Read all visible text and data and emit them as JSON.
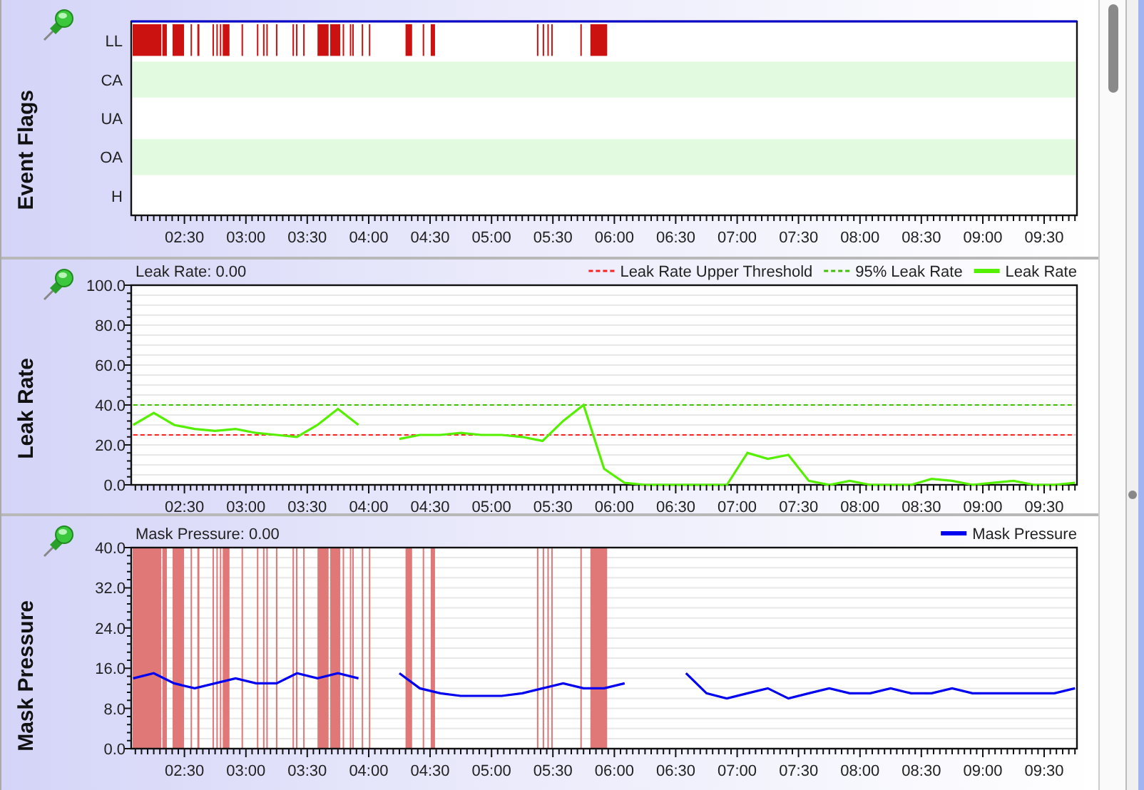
{
  "panels": [
    {
      "kind": "events",
      "title": "Event Flags",
      "chart_data": {
        "type": "bar",
        "orientation": "horizontal",
        "categories": [
          "LL",
          "CA",
          "UA",
          "OA",
          "H"
        ],
        "xlim": [
          124,
          586
        ],
        "bands": [
          {
            "axis": "x",
            "from": 124.7,
            "to": 138.7
          },
          {
            "axis": "x",
            "from": 139.2,
            "to": 141.4
          },
          {
            "axis": "x",
            "from": 144.2,
            "to": 149.8
          },
          {
            "axis": "x",
            "from": 153,
            "to": 153.6
          },
          {
            "axis": "x",
            "from": 156.3,
            "to": 157.3
          },
          {
            "axis": "x",
            "from": 163.7,
            "to": 164.3
          },
          {
            "axis": "x",
            "from": 165.6,
            "to": 166.2
          },
          {
            "axis": "x",
            "from": 167.3,
            "to": 167.9
          },
          {
            "axis": "x",
            "from": 168.7,
            "to": 172
          },
          {
            "axis": "x",
            "from": 177.9,
            "to": 178.5
          },
          {
            "axis": "x",
            "from": 185.4,
            "to": 186
          },
          {
            "axis": "x",
            "from": 188.4,
            "to": 189
          },
          {
            "axis": "x",
            "from": 190,
            "to": 190.6
          },
          {
            "axis": "x",
            "from": 194.7,
            "to": 195.3
          },
          {
            "axis": "x",
            "from": 202.8,
            "to": 203.4
          },
          {
            "axis": "x",
            "from": 204.5,
            "to": 205.1
          },
          {
            "axis": "x",
            "from": 208,
            "to": 208.6
          },
          {
            "axis": "x",
            "from": 215,
            "to": 220.4
          },
          {
            "axis": "x",
            "from": 221.2,
            "to": 226.1
          },
          {
            "axis": "x",
            "from": 227.3,
            "to": 227.9
          },
          {
            "axis": "x",
            "from": 230.8,
            "to": 231.4
          },
          {
            "axis": "x",
            "from": 232,
            "to": 232.6
          },
          {
            "axis": "x",
            "from": 236.6,
            "to": 237.2
          },
          {
            "axis": "x",
            "from": 240.1,
            "to": 240.7
          },
          {
            "axis": "x",
            "from": 258,
            "to": 261.2
          },
          {
            "axis": "x",
            "from": 266.4,
            "to": 267
          },
          {
            "axis": "x",
            "from": 270.3,
            "to": 272.4
          },
          {
            "axis": "x",
            "from": 322.2,
            "to": 322.8
          },
          {
            "axis": "x",
            "from": 325,
            "to": 325.6
          },
          {
            "axis": "x",
            "from": 327.3,
            "to": 327.9
          },
          {
            "axis": "x",
            "from": 329.2,
            "to": 329.8
          },
          {
            "axis": "x",
            "from": 343.4,
            "to": 344
          },
          {
            "axis": "x",
            "from": 348.3,
            "to": 356.5
          }
        ],
        "xticks": [
          {
            "value": 150,
            "label": "02:30"
          },
          {
            "value": 180,
            "label": "03:00"
          },
          {
            "value": 210,
            "label": "03:30"
          },
          {
            "value": 240,
            "label": "04:00"
          },
          {
            "value": 270,
            "label": "04:30"
          },
          {
            "value": 300,
            "label": "05:00"
          },
          {
            "value": 330,
            "label": "05:30"
          },
          {
            "value": 360,
            "label": "06:00"
          },
          {
            "value": 390,
            "label": "06:30"
          },
          {
            "value": 420,
            "label": "07:00"
          },
          {
            "value": 450,
            "label": "07:30"
          },
          {
            "value": 480,
            "label": "08:00"
          },
          {
            "value": 510,
            "label": "08:30"
          },
          {
            "value": 540,
            "label": "09:00"
          },
          {
            "value": 570,
            "label": "09:30"
          }
        ]
      }
    },
    {
      "kind": "chart",
      "title": "Leak Rate",
      "readout": "Leak Rate: 0.00",
      "chart_data": {
        "type": "line",
        "xlim": [
          124,
          586
        ],
        "ylim": [
          0,
          100
        ],
        "grid": true,
        "legend": "top-right",
        "x": [
          125,
          135,
          145,
          155,
          165,
          175,
          185,
          195,
          205,
          215,
          225,
          235,
          245,
          255,
          265,
          275,
          285,
          295,
          305,
          315,
          325,
          335,
          345,
          355,
          365,
          375,
          385,
          395,
          405,
          415,
          425,
          435,
          445,
          455,
          465,
          475,
          485,
          495,
          505,
          515,
          525,
          535,
          545,
          555,
          565,
          575,
          585
        ],
        "series": [
          {
            "name": "Leak Rate Upper Threshold",
            "color": "#ff2020",
            "line_style": "dashed",
            "values": [
              25,
              25,
              25,
              25,
              25,
              25,
              25,
              25,
              25,
              25,
              25,
              25,
              25,
              25,
              25,
              25,
              25,
              25,
              25,
              25,
              25,
              25,
              25,
              25,
              25,
              25,
              25,
              25,
              25,
              25,
              25,
              25,
              25,
              25,
              25,
              25,
              25,
              25,
              25,
              25,
              25,
              25,
              25,
              25,
              25,
              25,
              25
            ]
          },
          {
            "name": "95% Leak Rate",
            "color": "#40c000",
            "line_style": "dashed",
            "values": [
              40,
              40,
              40,
              40,
              40,
              40,
              40,
              40,
              40,
              40,
              40,
              40,
              40,
              40,
              40,
              40,
              40,
              40,
              40,
              40,
              40,
              40,
              40,
              40,
              40,
              40,
              40,
              40,
              40,
              40,
              40,
              40,
              40,
              40,
              40,
              40,
              40,
              40,
              40,
              40,
              40,
              40,
              40,
              40,
              40,
              40,
              40
            ]
          },
          {
            "name": "Leak Rate",
            "color": "#55f000",
            "line_style": "solid",
            "values": [
              30,
              36,
              30,
              28,
              27,
              28,
              26,
              25,
              24,
              30,
              38,
              30,
              null,
              23,
              25,
              25,
              26,
              25,
              25,
              24,
              22,
              32,
              40,
              8,
              1,
              0,
              0,
              0,
              0,
              0,
              16,
              13,
              15,
              2,
              0,
              2,
              0,
              0,
              0,
              3,
              2,
              0,
              1,
              2,
              0,
              0,
              1
            ]
          }
        ],
        "xticks": [
          {
            "value": 150,
            "label": "02:30"
          },
          {
            "value": 180,
            "label": "03:00"
          },
          {
            "value": 210,
            "label": "03:30"
          },
          {
            "value": 240,
            "label": "04:00"
          },
          {
            "value": 270,
            "label": "04:30"
          },
          {
            "value": 300,
            "label": "05:00"
          },
          {
            "value": 330,
            "label": "05:30"
          },
          {
            "value": 360,
            "label": "06:00"
          },
          {
            "value": 390,
            "label": "06:30"
          },
          {
            "value": 420,
            "label": "07:00"
          },
          {
            "value": 450,
            "label": "07:30"
          },
          {
            "value": 480,
            "label": "08:00"
          },
          {
            "value": 510,
            "label": "08:30"
          },
          {
            "value": 540,
            "label": "09:00"
          },
          {
            "value": 570,
            "label": "09:30"
          }
        ],
        "yticks": [
          {
            "value": 0,
            "label": "0.0"
          },
          {
            "value": 20,
            "label": "20.0"
          },
          {
            "value": 40,
            "label": "40.0"
          },
          {
            "value": 60,
            "label": "60.0"
          },
          {
            "value": 80,
            "label": "80.0"
          },
          {
            "value": 100,
            "label": "100.0"
          }
        ]
      }
    },
    {
      "kind": "chart",
      "title": "Mask Pressure",
      "readout": "Mask Pressure: 0.00",
      "chart_data": {
        "type": "line",
        "xlim": [
          124,
          586
        ],
        "ylim": [
          0,
          40
        ],
        "grid": true,
        "legend": "top-right",
        "x": [
          125,
          135,
          145,
          155,
          165,
          175,
          185,
          195,
          205,
          215,
          225,
          235,
          245,
          255,
          265,
          275,
          285,
          295,
          305,
          315,
          325,
          335,
          345,
          355,
          365,
          375,
          385,
          395,
          405,
          415,
          425,
          435,
          445,
          455,
          465,
          475,
          485,
          495,
          505,
          515,
          525,
          535,
          545,
          555,
          565,
          575,
          585
        ],
        "series": [
          {
            "name": "Mask Pressure",
            "color": "#0000f0",
            "line_style": "solid",
            "values": [
              14,
              15,
              13,
              12,
              13,
              14,
              13,
              13,
              15,
              14,
              15,
              14,
              null,
              15,
              12,
              11,
              10.5,
              10.5,
              10.5,
              11,
              12,
              13,
              12,
              12,
              13,
              null,
              null,
              15,
              11,
              10,
              11,
              12,
              10,
              11,
              12,
              11,
              11,
              12,
              11,
              11,
              12,
              11,
              11,
              11,
              11,
              11,
              12
            ]
          }
        ],
        "bands": [
          {
            "axis": "x",
            "from": 124.7,
            "to": 138.7
          },
          {
            "axis": "x",
            "from": 139.2,
            "to": 141.4
          },
          {
            "axis": "x",
            "from": 144.2,
            "to": 149.8
          },
          {
            "axis": "x",
            "from": 153,
            "to": 153.6
          },
          {
            "axis": "x",
            "from": 156.3,
            "to": 157.3
          },
          {
            "axis": "x",
            "from": 163.7,
            "to": 164.3
          },
          {
            "axis": "x",
            "from": 165.6,
            "to": 166.2
          },
          {
            "axis": "x",
            "from": 167.3,
            "to": 167.9
          },
          {
            "axis": "x",
            "from": 168.7,
            "to": 172
          },
          {
            "axis": "x",
            "from": 177.9,
            "to": 178.5
          },
          {
            "axis": "x",
            "from": 185.4,
            "to": 186
          },
          {
            "axis": "x",
            "from": 188.4,
            "to": 189
          },
          {
            "axis": "x",
            "from": 190,
            "to": 190.6
          },
          {
            "axis": "x",
            "from": 194.7,
            "to": 195.3
          },
          {
            "axis": "x",
            "from": 202.8,
            "to": 203.4
          },
          {
            "axis": "x",
            "from": 204.5,
            "to": 205.1
          },
          {
            "axis": "x",
            "from": 208,
            "to": 208.6
          },
          {
            "axis": "x",
            "from": 215,
            "to": 220.4
          },
          {
            "axis": "x",
            "from": 221.2,
            "to": 226.1
          },
          {
            "axis": "x",
            "from": 227.3,
            "to": 227.9
          },
          {
            "axis": "x",
            "from": 230.8,
            "to": 231.4
          },
          {
            "axis": "x",
            "from": 232,
            "to": 232.6
          },
          {
            "axis": "x",
            "from": 236.6,
            "to": 237.2
          },
          {
            "axis": "x",
            "from": 240.1,
            "to": 240.7
          },
          {
            "axis": "x",
            "from": 258,
            "to": 261.2
          },
          {
            "axis": "x",
            "from": 266.4,
            "to": 267
          },
          {
            "axis": "x",
            "from": 270.3,
            "to": 272.4
          },
          {
            "axis": "x",
            "from": 322.2,
            "to": 322.8
          },
          {
            "axis": "x",
            "from": 325,
            "to": 325.6
          },
          {
            "axis": "x",
            "from": 327.3,
            "to": 327.9
          },
          {
            "axis": "x",
            "from": 329.2,
            "to": 329.8
          },
          {
            "axis": "x",
            "from": 343.4,
            "to": 344
          },
          {
            "axis": "x",
            "from": 348.3,
            "to": 356.5
          }
        ],
        "xticks": [
          {
            "value": 150,
            "label": "02:30"
          },
          {
            "value": 180,
            "label": "03:00"
          },
          {
            "value": 210,
            "label": "03:30"
          },
          {
            "value": 240,
            "label": "04:00"
          },
          {
            "value": 270,
            "label": "04:30"
          },
          {
            "value": 300,
            "label": "05:00"
          },
          {
            "value": 330,
            "label": "05:30"
          },
          {
            "value": 360,
            "label": "06:00"
          },
          {
            "value": 390,
            "label": "06:30"
          },
          {
            "value": 420,
            "label": "07:00"
          },
          {
            "value": 450,
            "label": "07:30"
          },
          {
            "value": 480,
            "label": "08:00"
          },
          {
            "value": 510,
            "label": "08:30"
          },
          {
            "value": 540,
            "label": "09:00"
          },
          {
            "value": 570,
            "label": "09:30"
          }
        ],
        "yticks": [
          {
            "value": 0,
            "label": "0.0"
          },
          {
            "value": 8,
            "label": "8.0"
          },
          {
            "value": 16,
            "label": "16.0"
          },
          {
            "value": 24,
            "label": "24.0"
          },
          {
            "value": 32,
            "label": "32.0"
          },
          {
            "value": 40,
            "label": "40.0"
          }
        ]
      }
    }
  ]
}
